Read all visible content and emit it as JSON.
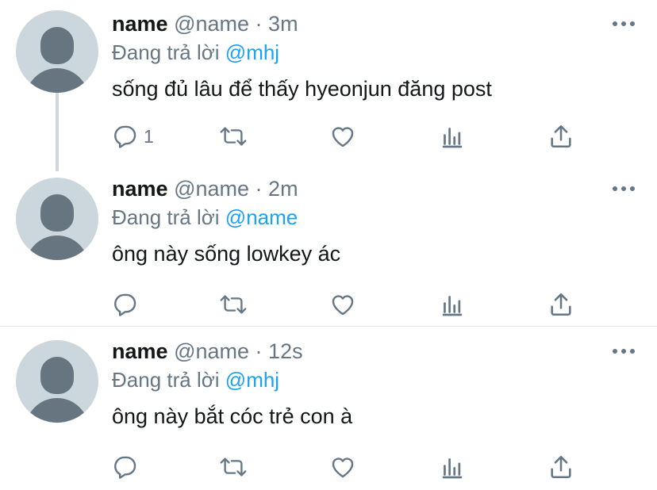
{
  "colors": {
    "text_primary": "#14171a",
    "text_secondary": "#657786",
    "accent": "#1da1f2",
    "avatar_bg": "#ccd6dd",
    "avatar_fg": "#66757f",
    "thread_line": "#cfd9de"
  },
  "icons": {
    "reply": "reply-icon",
    "retweet": "retweet-icon",
    "like": "heart-icon",
    "analytics": "analytics-icon",
    "share": "share-icon",
    "more": "more-icon"
  },
  "tweets": [
    {
      "name": "name",
      "handle": "@name",
      "separator": "·",
      "time": "3m",
      "replying_prefix": "Đang trả lời",
      "replying_to": "@mhj",
      "text": "sống đủ lâu để thấy hyeonjun đăng post",
      "reply_count": "1"
    },
    {
      "name": "name",
      "handle": "@name",
      "separator": "·",
      "time": "2m",
      "replying_prefix": "Đang trả lời",
      "replying_to": "@name",
      "text": "ông này sống lowkey ác",
      "reply_count": ""
    },
    {
      "name": "name",
      "handle": "@name",
      "separator": "·",
      "time": "12s",
      "replying_prefix": "Đang trả lời",
      "replying_to": "@mhj",
      "text": "ông này bắt cóc trẻ con à",
      "reply_count": ""
    }
  ]
}
